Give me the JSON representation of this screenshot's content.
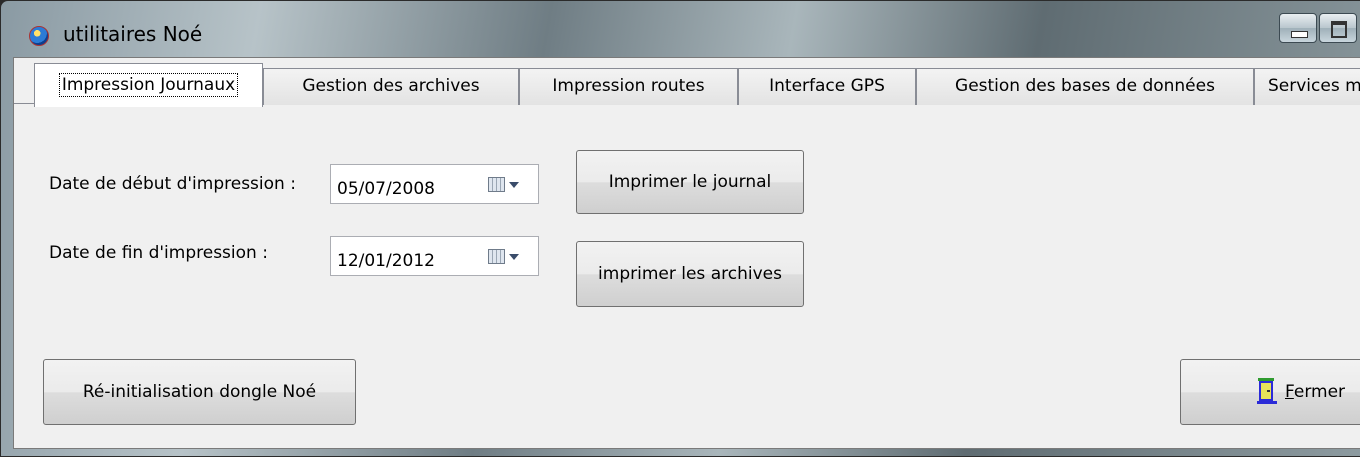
{
  "window": {
    "title": "utilitaires Noé"
  },
  "tabs": [
    {
      "label": "Impression Journaux",
      "active": true
    },
    {
      "label": "Gestion des archives",
      "active": false
    },
    {
      "label": "Impression routes",
      "active": false
    },
    {
      "label": "Interface GPS",
      "active": false
    },
    {
      "label": "Gestion des bases de données",
      "active": false
    },
    {
      "label": "Services m",
      "active": false
    }
  ],
  "form": {
    "start_label": "Date de début d'impression :",
    "start_value": "05/07/2008",
    "end_label": "Date de fin d'impression :",
    "end_value": "12/01/2012"
  },
  "buttons": {
    "print_journal": "Imprimer le  journal",
    "print_archives": "imprimer les archives",
    "reset_dongle": "Ré-initialisation dongle Noé",
    "close_mnemonic": "F",
    "close_rest": "ermer"
  },
  "icons": {
    "app": "globe-icon",
    "calendar": "calendar-icon",
    "close": "door-exit-icon"
  }
}
